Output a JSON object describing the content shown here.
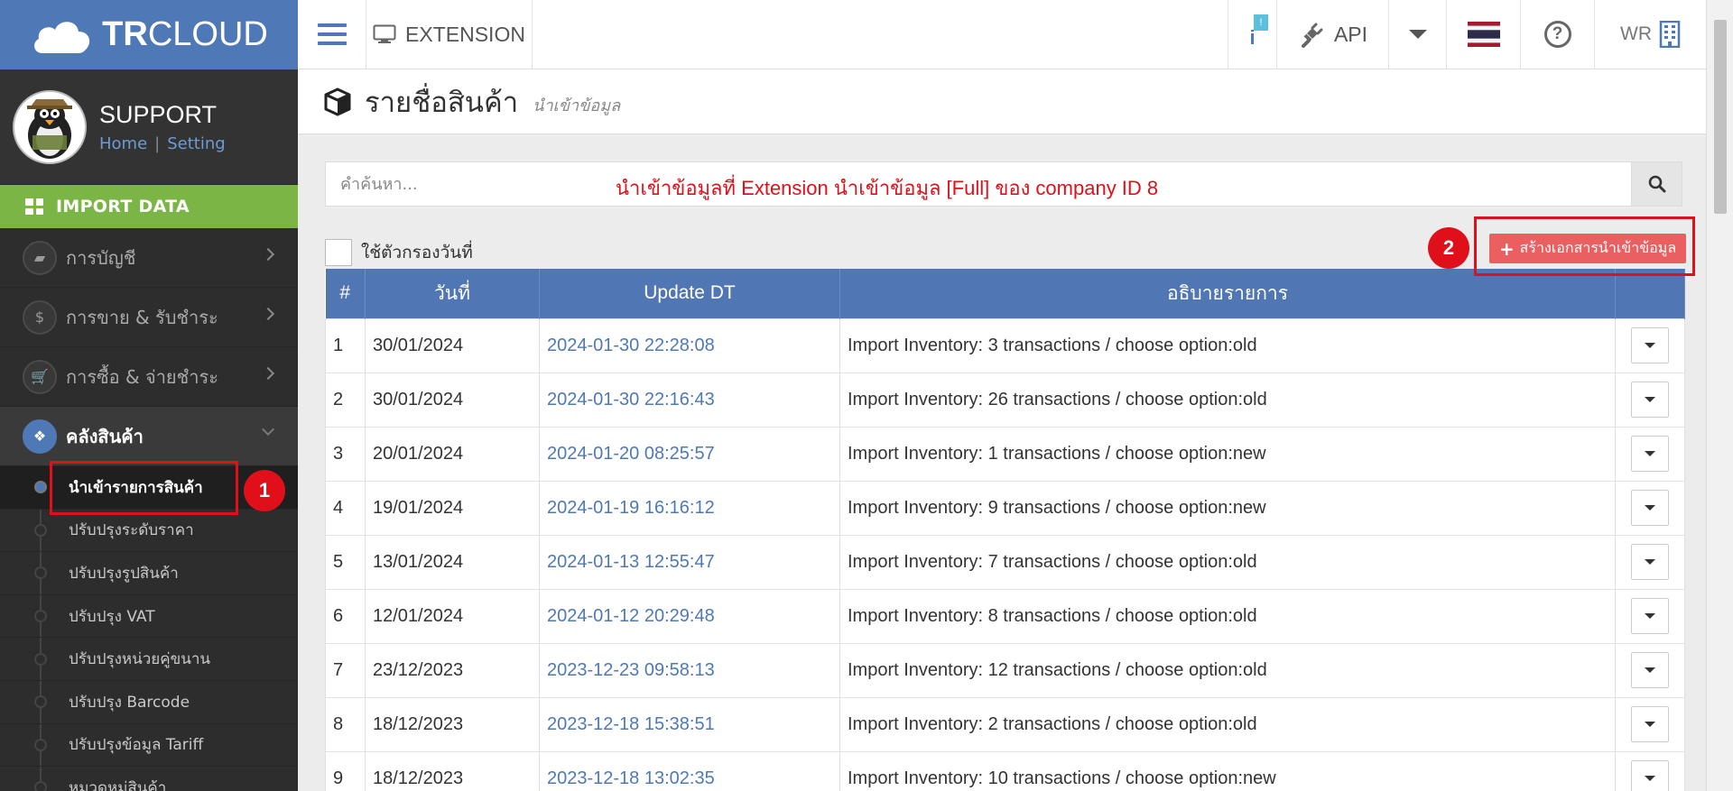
{
  "brand": {
    "name_bold": "TR",
    "name_regular": "CLOUD"
  },
  "profile": {
    "username": "SUPPORT",
    "home_link": "Home",
    "separator": "|",
    "setting_link": "Setting"
  },
  "sidebar": {
    "section": "IMPORT DATA",
    "items": [
      {
        "label": "การบัญชี",
        "icon": "book-icon",
        "glyph": "▰"
      },
      {
        "label": "การขาย & รับชำระ",
        "icon": "dollar-icon",
        "glyph": "$"
      },
      {
        "label": "การซื้อ & จ่ายชำระ",
        "icon": "cart-icon",
        "glyph": "🛒"
      },
      {
        "label": "คลังสินค้า",
        "icon": "cubes-icon",
        "glyph": "❖"
      }
    ],
    "subitems": [
      "นำเข้ารายการสินค้า",
      "ปรับปรุงระดับราคา",
      "ปรับปรุงรูปสินค้า",
      "ปรับปรุง VAT",
      "ปรับปรุงหน่วยคู่ขนาน",
      "ปรับปรุง Barcode",
      "ปรับปรุงข้อมูล Tariff",
      "หมวดหมู่สินค้า"
    ]
  },
  "topbar": {
    "extension_label": "EXTENSION",
    "info_glyph": "i",
    "info_badge": "!",
    "api_label": "API",
    "user_label": "WR"
  },
  "page": {
    "title": "รายชื่อสินค้า",
    "subtitle": "นำเข้าข้อมูล"
  },
  "search": {
    "placeholder": "คำค้นหา...",
    "annotation": "นำเข้าข้อมูลที่ Extension นำเข้าข้อมูล [Full] ของ company ID 8"
  },
  "filter": {
    "date_label": "ใช้ตัวกรองวันที่"
  },
  "create_button": {
    "plus": "+",
    "label": "สร้างเอกสารนำเข้าข้อมูล"
  },
  "annotations": {
    "badge1": "1",
    "badge2": "2"
  },
  "table": {
    "headers": [
      "#",
      "วันที่",
      "Update DT",
      "อธิบายรายการ",
      ""
    ],
    "rows": [
      [
        "1",
        "30/01/2024",
        "2024-01-30 22:28:08",
        "Import Inventory: 3 transactions / choose option:old"
      ],
      [
        "2",
        "30/01/2024",
        "2024-01-30 22:16:43",
        "Import Inventory: 26 transactions / choose option:old"
      ],
      [
        "3",
        "20/01/2024",
        "2024-01-20 08:25:57",
        "Import Inventory: 1 transactions / choose option:new"
      ],
      [
        "4",
        "19/01/2024",
        "2024-01-19 16:16:12",
        "Import Inventory: 9 transactions / choose option:new"
      ],
      [
        "5",
        "13/01/2024",
        "2024-01-13 12:55:47",
        "Import Inventory: 7 transactions / choose option:old"
      ],
      [
        "6",
        "12/01/2024",
        "2024-01-12 20:29:48",
        "Import Inventory: 8 transactions / choose option:old"
      ],
      [
        "7",
        "23/12/2023",
        "2023-12-23 09:58:13",
        "Import Inventory: 12 transactions / choose option:old"
      ],
      [
        "8",
        "18/12/2023",
        "2023-12-18 15:38:51",
        "Import Inventory: 2 transactions / choose option:old"
      ],
      [
        "9",
        "18/12/2023",
        "2023-12-18 13:02:35",
        "Import Inventory: 10 transactions / choose option:new"
      ]
    ]
  },
  "colors": {
    "brand_blue": "#4f79b6",
    "import_green": "#7bb545",
    "accent_red": "#e0101a",
    "create_button": "#ea5f5f"
  }
}
